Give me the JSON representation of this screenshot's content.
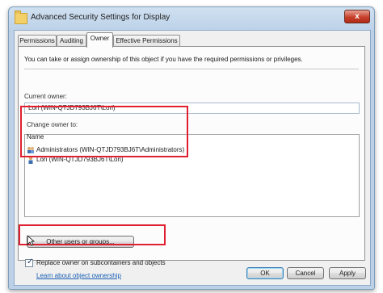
{
  "window": {
    "title": "Advanced Security Settings for Display",
    "close_label": "x"
  },
  "tabs": [
    {
      "label": "Permissions",
      "active": false
    },
    {
      "label": "Auditing",
      "active": false
    },
    {
      "label": "Owner",
      "active": true
    },
    {
      "label": "Effective Permissions",
      "active": false
    }
  ],
  "owner_tab": {
    "info_text": "You can take or assign ownership of this object if you have the required permissions or privileges.",
    "current_owner_label": "Current owner:",
    "current_owner_value": "Lori (WIN-QTJD793BJ6T\\Lori)",
    "change_owner_label": "Change owner to:",
    "list_header": "Name",
    "list_items": [
      {
        "label": "Administrators (WIN-QTJD793BJ6T\\Administrators)",
        "icon": "group-icon"
      },
      {
        "label": "Lori (WIN-QTJD793BJ6T\\Lori)",
        "icon": "user-icon"
      }
    ],
    "other_users_button": "Other users or groups...",
    "replace_owner_label": "Replace owner on subcontainers and objects",
    "replace_owner_checked": true,
    "learn_more_link": "Learn about object ownership"
  },
  "footer": {
    "ok_label": "OK",
    "cancel_label": "Cancel",
    "apply_label": "Apply"
  },
  "colors": {
    "highlight": "#e02030",
    "link": "#1a5fb4"
  }
}
